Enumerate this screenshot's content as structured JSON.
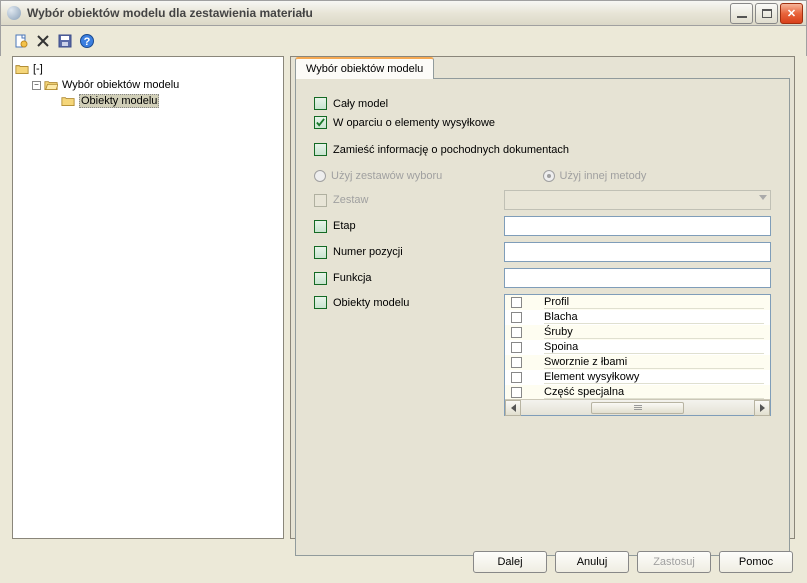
{
  "window": {
    "title": "Wybór obiektów modelu dla zestawienia materiału"
  },
  "tree": {
    "root_label": "[-]",
    "child_label": "Wybór obiektów modelu",
    "grandchild_label": "Obiekty modelu"
  },
  "tab": {
    "label": "Wybór obiektów modelu"
  },
  "form": {
    "whole_model": "Cały model",
    "based_on_shipping": "W oparciu o elementy wysyłkowe",
    "include_info": "Zamieść informację o pochodnych dokumentach",
    "use_selection_sets": "Użyj zestawów wyboru",
    "use_other_method": "Użyj innej metody",
    "set": "Zestaw",
    "stage": "Etap",
    "position_no": "Numer pozycji",
    "function": "Funkcja",
    "model_objects": "Obiekty modelu"
  },
  "obj_items": {
    "i0": "Profil",
    "i1": "Blacha",
    "i2": "Śruby",
    "i3": "Spoina",
    "i4": "Sworznie z łbami",
    "i5": "Element wysyłkowy",
    "i6": "Część specjalna"
  },
  "buttons": {
    "next": "Dalej",
    "cancel": "Anuluj",
    "apply": "Zastosuj",
    "help": "Pomoc"
  }
}
